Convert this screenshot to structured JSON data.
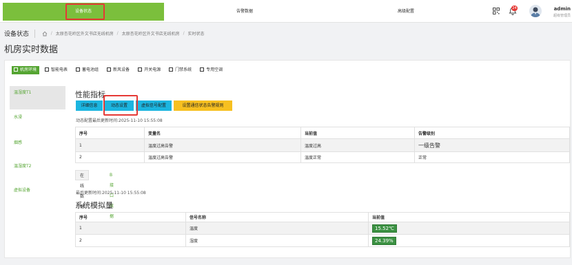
{
  "nav": {
    "tabs": [
      {
        "label": "设备状态",
        "active": true
      },
      {
        "label": "告警数据",
        "active": false
      },
      {
        "label": "高级配置",
        "active": false
      }
    ],
    "bell_badge": "24",
    "user_name": "admin",
    "user_role": "超级管理员"
  },
  "breadcrumb": {
    "title": "设备状态",
    "items": [
      "太原杏花岭区外文书店无线机房",
      "太原杏花岭区外文书店无线机房",
      "实时状态"
    ]
  },
  "page_title": "机房实时数据",
  "categories": [
    {
      "label": "机房环境",
      "active": true
    },
    {
      "label": "智能电表",
      "active": false
    },
    {
      "label": "蓄电池组",
      "active": false
    },
    {
      "label": "新风设备",
      "active": false
    },
    {
      "label": "开关电源",
      "active": false
    },
    {
      "label": "门禁系统",
      "active": false
    },
    {
      "label": "专用空调",
      "active": false
    }
  ],
  "left_nav": [
    {
      "label": "温湿度T1",
      "active": true
    },
    {
      "label": "水浸",
      "active": false
    },
    {
      "label": "烟感",
      "active": false
    },
    {
      "label": "温湿度T2",
      "active": false
    },
    {
      "label": "虚拟设备",
      "active": false
    }
  ],
  "perf": {
    "title": "性能指标",
    "buttons": {
      "detail": "详细信息",
      "dynamic": "动态设置",
      "virtual": "虚拟信号配置",
      "alarm_rule": "设置通信状态告警规则"
    },
    "dynamic_time": "动态配置最后更新时间:2025-11-10 15:55:08",
    "table": {
      "headers": [
        "序号",
        "变量名",
        "当前值",
        "告警级别"
      ],
      "rows": [
        [
          "1",
          "温度过高告警",
          "温度过高",
          "一级告警"
        ],
        [
          "2",
          "温度过高告警",
          "温度正常",
          "正常"
        ]
      ]
    }
  },
  "sub_tabs": [
    "在线数据",
    "B接口数据"
  ],
  "update_time": "最后更新时间:2025-11-10 15:55:08",
  "sim": {
    "title": "系统模拟量",
    "table": {
      "headers": [
        "序号",
        "信号名称",
        "当前值"
      ],
      "rows": [
        [
          "1",
          "温度",
          "15.52℃"
        ],
        [
          "2",
          "湿度",
          "24.39%"
        ]
      ]
    }
  },
  "colors": {
    "accent": "#7bbf3c",
    "info_button": "#1bb5e0",
    "warn_button": "#f7c020",
    "value_green": "#3b9142",
    "highlight_red": "#e53935"
  }
}
